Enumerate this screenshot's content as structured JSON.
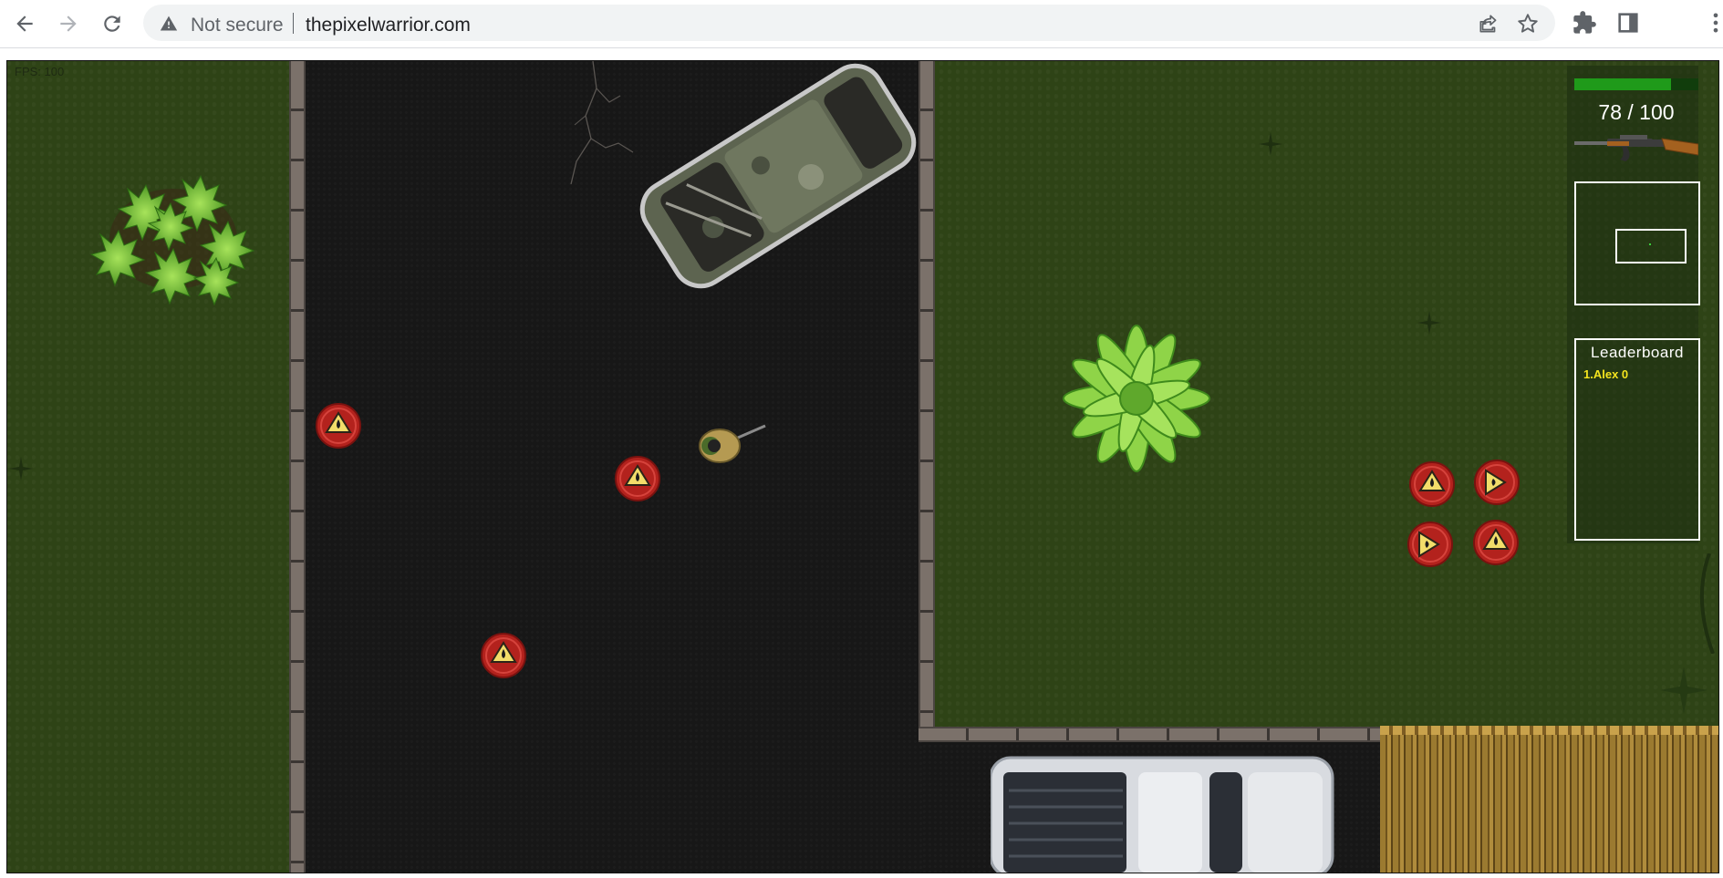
{
  "browser": {
    "security_label": "Not secure",
    "url": "thepixelwarrior.com",
    "icons": [
      "back-arrow-icon",
      "forward-arrow-icon",
      "reload-icon",
      "warning-triangle-icon",
      "share-icon",
      "star-icon",
      "extensions-puzzle-icon",
      "side-panel-icon",
      "kebab-menu-icon"
    ]
  },
  "game": {
    "fps_label": "FPS: 100",
    "health": {
      "text": "78 / 100",
      "fraction": 0.78,
      "bar_color": "#1f9a1a"
    },
    "weapon_icon": "assault-rifle-icon",
    "leaderboard": {
      "title": "Leaderboard",
      "entries": [
        "1.Alex 0"
      ],
      "entry_color": "#f4e41e"
    }
  }
}
